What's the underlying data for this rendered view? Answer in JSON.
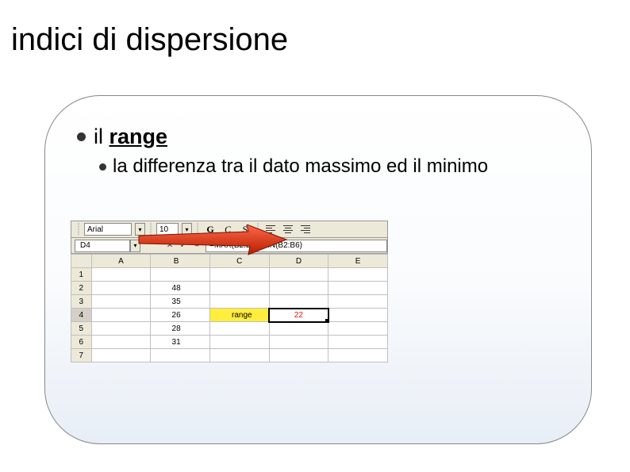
{
  "slide": {
    "title": "indici di dispersione",
    "bullet1_prefix": "il ",
    "bullet1_range": "range",
    "bullet2": "la differenza tra il dato massimo ed il minimo"
  },
  "toolbar": {
    "font_name": "Arial",
    "font_size": "10",
    "bold": "G",
    "italic": "C",
    "underline": "S"
  },
  "namebox": {
    "cell_ref": "D4",
    "formula": "=MAX(B2:B6)-MIN(B2:B6)"
  },
  "columns": {
    "A": "A",
    "B": "B",
    "C": "C",
    "D": "D",
    "E": "E"
  },
  "rows": {
    "r1": "1",
    "r2": "2",
    "r3": "3",
    "r4": "4",
    "r5": "5",
    "r6": "6",
    "r7": "7"
  },
  "cells": {
    "B2": "48",
    "B3": "35",
    "B4": "26",
    "B5": "28",
    "B6": "31",
    "C4": "range",
    "D4": "22"
  }
}
